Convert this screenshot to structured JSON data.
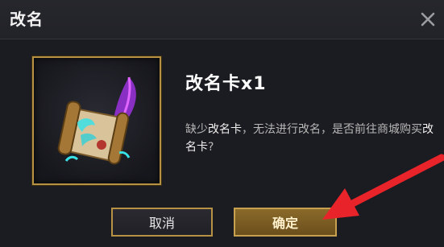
{
  "dialog": {
    "title": "改名",
    "close_icon": "close-icon",
    "item": {
      "name": "改名卡",
      "count": "x1",
      "icon": "rename-card-scroll-quill-icon"
    },
    "message": {
      "part1": "缺少",
      "highlight1": "改名卡",
      "part2": "，无法进行改名，是否前往商城购买",
      "highlight2": "改名卡",
      "part3": "?"
    },
    "buttons": {
      "cancel": "取消",
      "confirm": "确定"
    }
  },
  "colors": {
    "frame_gold": "#b89244",
    "confirm_bg": "#7a5c22",
    "annotation_arrow": "#e8232a"
  },
  "annotation": {
    "icon": "red-arrow-annotation"
  }
}
